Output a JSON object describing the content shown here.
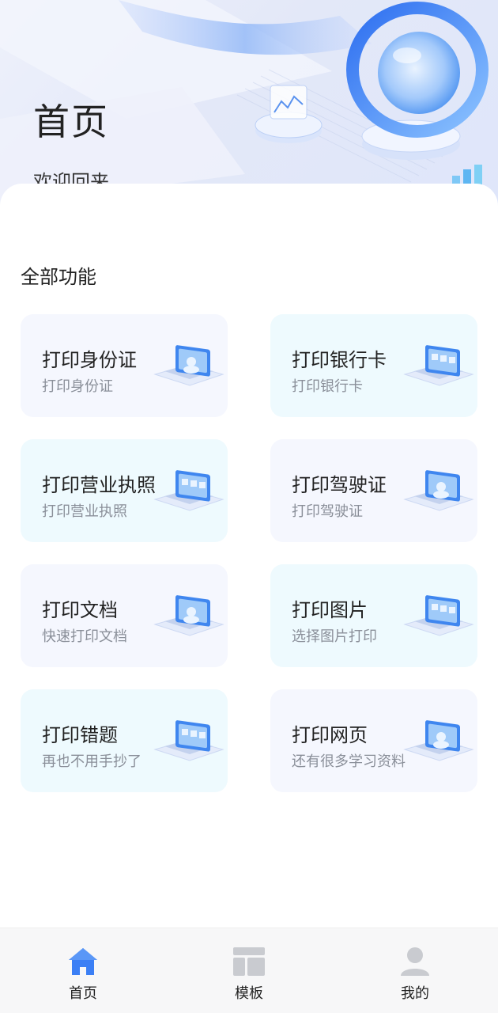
{
  "header": {
    "title": "首页",
    "subtitle": "欢迎回来"
  },
  "section": {
    "title": "全部功能"
  },
  "features": [
    {
      "title": "打印身份证",
      "subtitle": "打印身份证",
      "icon": "id-card-print-icon"
    },
    {
      "title": "打印银行卡",
      "subtitle": "打印银行卡",
      "icon": "bank-card-print-icon"
    },
    {
      "title": "打印营业执照",
      "subtitle": "打印营业执照",
      "icon": "business-license-print-icon"
    },
    {
      "title": "打印驾驶证",
      "subtitle": "打印驾驶证",
      "icon": "driver-license-print-icon"
    },
    {
      "title": "打印文档",
      "subtitle": "快速打印文档",
      "icon": "document-print-icon"
    },
    {
      "title": "打印图片",
      "subtitle": "选择图片打印",
      "icon": "picture-print-icon"
    },
    {
      "title": "打印错题",
      "subtitle": "再也不用手抄了",
      "icon": "wrong-questions-print-icon"
    },
    {
      "title": "打印网页",
      "subtitle": "还有很多学习资料",
      "icon": "webpage-print-icon"
    }
  ],
  "tabbar": {
    "items": [
      {
        "label": "首页",
        "icon": "home-icon",
        "active": true
      },
      {
        "label": "模板",
        "icon": "template-icon",
        "active": false
      },
      {
        "label": "我的",
        "icon": "user-icon",
        "active": false
      }
    ]
  },
  "colors": {
    "accent": "#3b7ff5",
    "inactive_icon": "#c9cbd0",
    "card_lavender": "#f5f7fe",
    "card_blue": "#eefafe"
  }
}
